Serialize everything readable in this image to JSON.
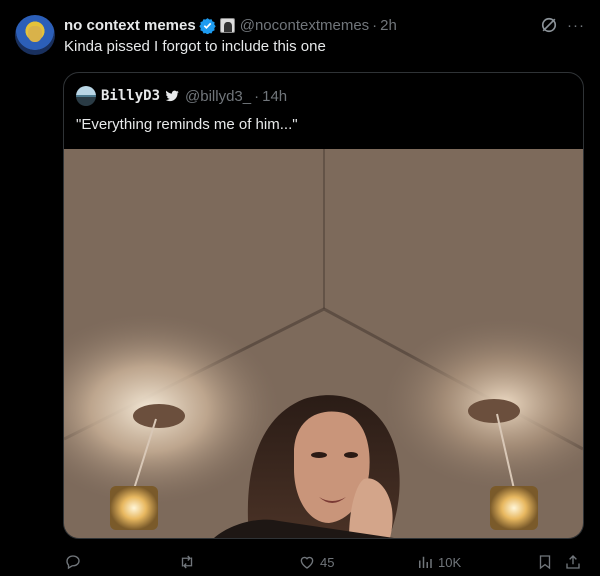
{
  "tweet": {
    "display_name": "no context memes",
    "handle": "@nocontextmemes",
    "separator": "·",
    "time": "2h",
    "text": "Kinda pissed I forgot to include this one",
    "icons": [
      "avatar",
      "verified-badge-icon",
      "affiliate-badge-icon",
      "grok-icon",
      "more-icon"
    ]
  },
  "quote": {
    "display_name": "BillyD3",
    "handle": "@billyd3_",
    "separator": "·",
    "time": "14h",
    "text": "\"Everything reminds me of him...\"",
    "icons": [
      "quote-avatar",
      "bird-icon"
    ],
    "image": "photo-woman-under-lamps"
  },
  "actions": {
    "reply_count": "",
    "retweet_count": "",
    "like_count": "45",
    "views_count": "10K",
    "icons": [
      "reply-icon",
      "retweet-icon",
      "like-icon",
      "views-icon",
      "bookmark-icon",
      "share-icon"
    ]
  },
  "colors": {
    "background": "#000000",
    "text_primary": "#e7e9ea",
    "text_secondary": "#71767b",
    "border": "#2f3336",
    "verified_blue": "#1d9bf0"
  }
}
